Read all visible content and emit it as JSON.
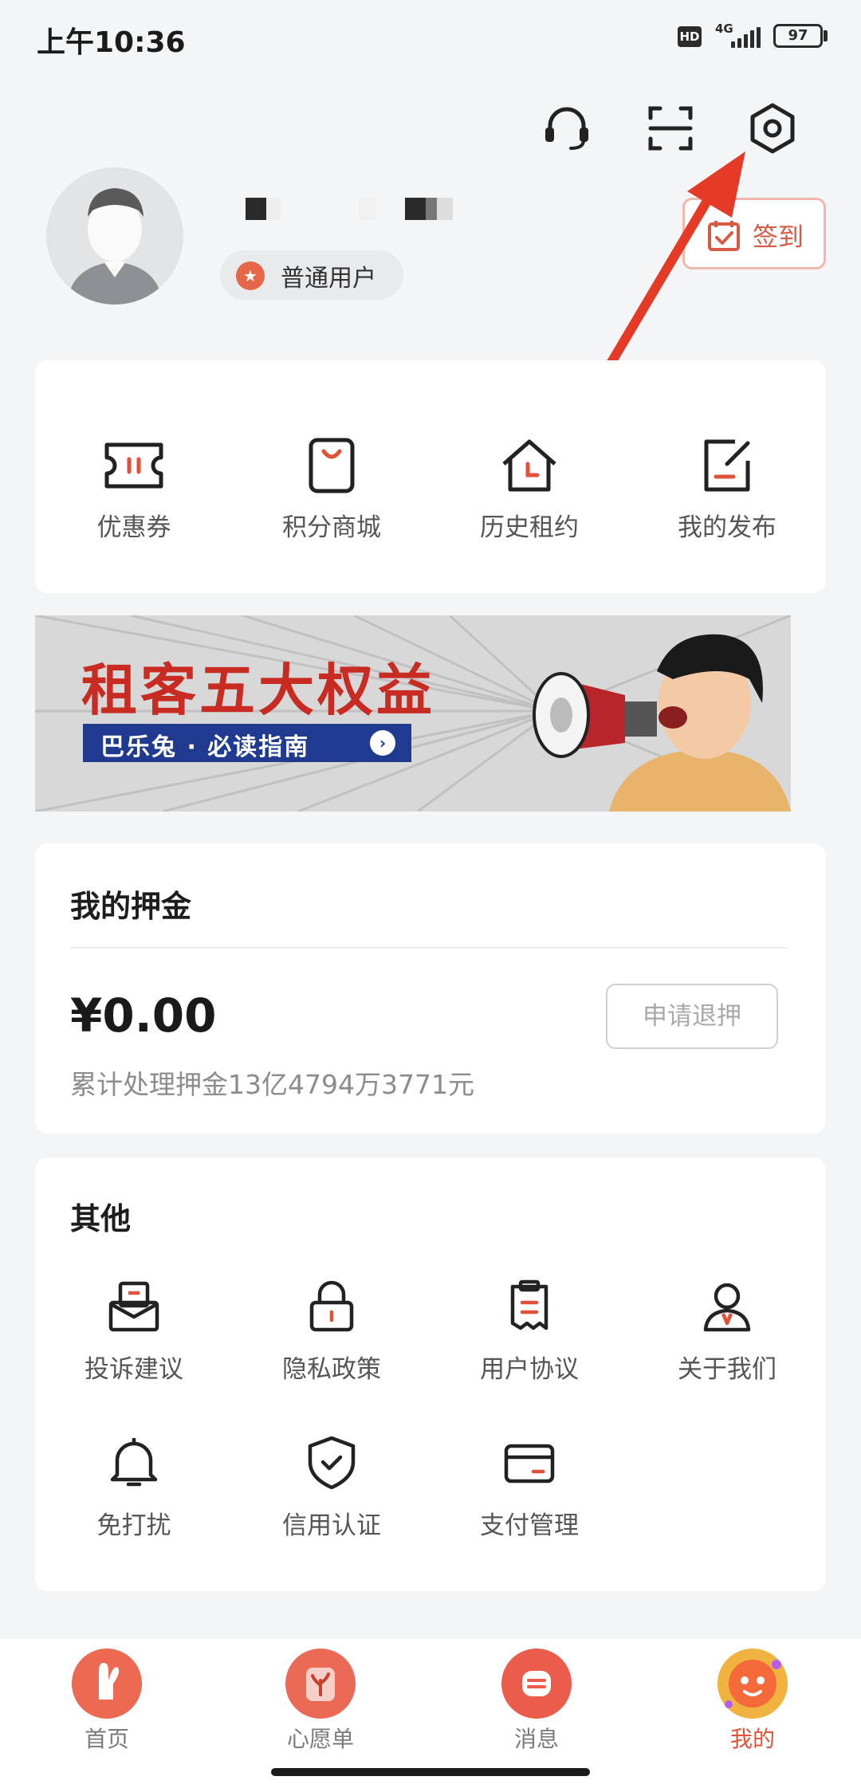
{
  "status_bar": {
    "time": "上午10:36",
    "hd": "HD",
    "network": "4G",
    "battery": "97"
  },
  "profile": {
    "level": "普通用户",
    "signin_label": "签到"
  },
  "quick_links": [
    {
      "label": "优惠券",
      "icon": "coupon-icon"
    },
    {
      "label": "积分商城",
      "icon": "shopping-bag-icon"
    },
    {
      "label": "历史租约",
      "icon": "house-clock-icon"
    },
    {
      "label": "我的发布",
      "icon": "edit-note-icon"
    }
  ],
  "banner": {
    "title": "租客五大权益",
    "subtitle": "巴乐兔 · 必读指南"
  },
  "deposit": {
    "title": "我的押金",
    "amount": "¥0.00",
    "stat": "累计处理押金13亿4794万3771元",
    "refund_label": "申请退押"
  },
  "other": {
    "title": "其他",
    "items": [
      {
        "label": "投诉建议",
        "icon": "mailbox-icon"
      },
      {
        "label": "隐私政策",
        "icon": "lock-icon"
      },
      {
        "label": "用户协议",
        "icon": "clipboard-icon"
      },
      {
        "label": "关于我们",
        "icon": "person-icon"
      },
      {
        "label": "免打扰",
        "icon": "bell-icon"
      },
      {
        "label": "信用认证",
        "icon": "shield-check-icon"
      },
      {
        "label": "支付管理",
        "icon": "card-icon"
      }
    ]
  },
  "tabs": [
    {
      "label": "首页",
      "icon": "rabbit-home-icon"
    },
    {
      "label": "心愿单",
      "icon": "wish-jar-icon"
    },
    {
      "label": "消息",
      "icon": "message-icon"
    },
    {
      "label": "我的",
      "icon": "mascot-icon"
    }
  ],
  "colors": {
    "accent": "#e0523a",
    "banner_red": "#c72b22",
    "banner_blue": "#1f3a8e"
  }
}
